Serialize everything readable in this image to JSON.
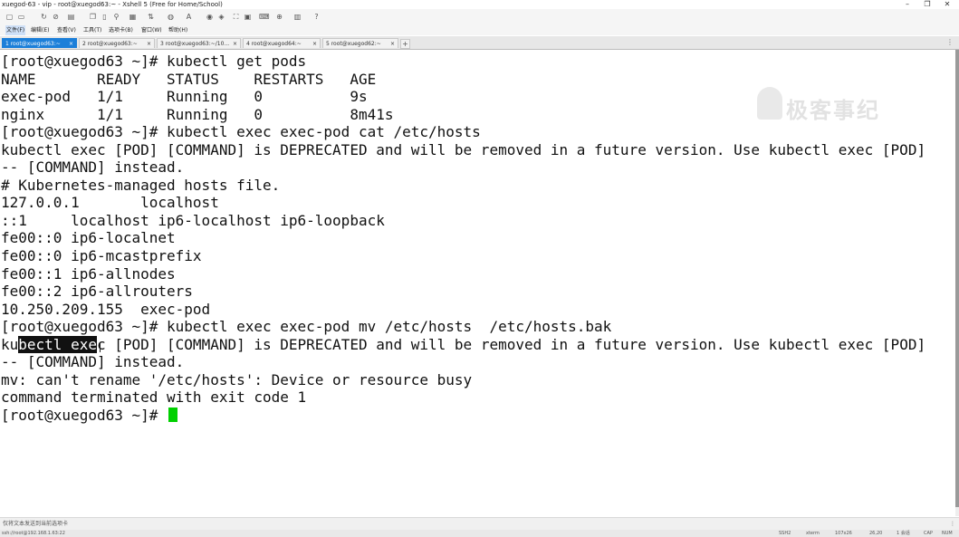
{
  "window": {
    "title": "xuegod-63 - vip - root@xuegod63:~ - Xshell 5 (Free for Home/School)",
    "controls": [
      "–",
      "❐",
      "✕"
    ]
  },
  "toolbar": {
    "icons": [
      "new-session-icon",
      "open-icon",
      "reconnect-icon",
      "disconnect-icon",
      "properties-icon",
      "copy-icon",
      "paste-icon",
      "find-icon",
      "print-icon",
      "transfer-icon",
      "globe-icon",
      "font-icon",
      "xftp-icon",
      "script-icon",
      "fullscreen-icon",
      "lock-icon",
      "keyboard-icon",
      "add-icon",
      "layout-icon",
      "help-icon"
    ]
  },
  "menubar": {
    "items": [
      "文件(F)",
      "编辑(E)",
      "查看(V)",
      "工具(T)",
      "选项卡(B)",
      "窗口(W)",
      "帮助(H)"
    ]
  },
  "tabs": [
    {
      "label": "1 root@xuegod63:~",
      "active": true
    },
    {
      "label": "2 root@xuegod63:~",
      "active": false
    },
    {
      "label": "3 root@xuegod63:~/10...",
      "active": false
    },
    {
      "label": "4 root@xuegod64:~",
      "active": false
    },
    {
      "label": "5 root@xuegod62:~",
      "active": false
    }
  ],
  "tab_add": "+",
  "tab_menu": "⋮",
  "terminal": {
    "lines": [
      "[root@xuegod63 ~]# kubectl get pods",
      "NAME       READY   STATUS    RESTARTS   AGE",
      "exec-pod   1/1     Running   0          9s",
      "nginx      1/1     Running   0          8m41s",
      "[root@xuegod63 ~]# kubectl exec exec-pod cat /etc/hosts",
      "kubectl exec [POD] [COMMAND] is DEPRECATED and will be removed in a future version. Use kubectl exec [POD]",
      "-- [COMMAND] instead.",
      "# Kubernetes-managed hosts file.",
      "127.0.0.1       localhost",
      "::1     localhost ip6-localhost ip6-loopback",
      "fe00::0 ip6-localnet",
      "fe00::0 ip6-mcastprefix",
      "fe00::1 ip6-allnodes",
      "fe00::2 ip6-allrouters",
      "10.250.209.155  exec-pod",
      "[root@xuegod63 ~]# kubectl exec exec-pod mv /etc/hosts  /etc/hosts.bak"
    ],
    "selected_line": {
      "before": "ku",
      "selected": "bectl exe",
      "after": "c [POD] [COMMAND] is DEPRECATED and will be removed in a future version. Use kubectl exec [POD]"
    },
    "after_lines": [
      "-- [COMMAND] instead.",
      "mv: can't rename '/etc/hosts': Device or resource busy",
      "command terminated with exit code 1"
    ],
    "prompt": "[root@xuegod63 ~]# ",
    "cursor_color": "#00d000"
  },
  "watermark": {
    "text": "极客事纪"
  },
  "statusbar": {
    "left": "仅将文本发送到当前选项卡",
    "right": "⋮"
  },
  "bottombar": {
    "session": "ssh://root@192.168.1.63:22",
    "items": [
      "SSH2",
      "xterm",
      "107x26",
      "26,20",
      "1 会话",
      "CAP",
      "NUM"
    ]
  },
  "colors": {
    "active_tab": "#1c7fd9",
    "terminal_bg": "#ffffff",
    "terminal_fg": "#111111"
  }
}
